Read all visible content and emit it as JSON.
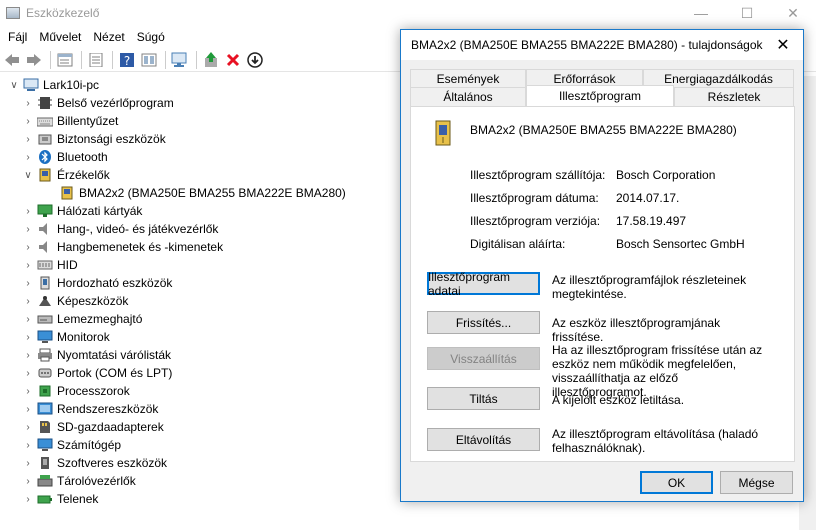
{
  "main": {
    "title": "Eszközkezelő",
    "menu": [
      "Fájl",
      "Művelet",
      "Nézet",
      "Súgó"
    ]
  },
  "tree": {
    "root": "Lark10i-pc",
    "items": [
      {
        "label": "Belső vezérlőprogram",
        "icon": "firmware-icon",
        "expanded": false
      },
      {
        "label": "Billentyűzet",
        "icon": "keyboard-icon",
        "expanded": false
      },
      {
        "label": "Biztonsági eszközök",
        "icon": "security-device-icon",
        "expanded": false
      },
      {
        "label": "Bluetooth",
        "icon": "bluetooth-icon",
        "expanded": false
      },
      {
        "label": "Érzékelők",
        "icon": "sensor-icon",
        "expanded": true
      },
      {
        "label": "BMA2x2 (BMA250E BMA255 BMA222E BMA280)",
        "icon": "sensor-device-icon",
        "child": true
      },
      {
        "label": "Hálózati kártyák",
        "icon": "network-icon",
        "expanded": false
      },
      {
        "label": "Hang-, videó- és játékvezérlők",
        "icon": "speaker-icon",
        "expanded": false
      },
      {
        "label": "Hangbemenetek és -kimenetek",
        "icon": "speaker-icon",
        "expanded": false
      },
      {
        "label": "HID",
        "icon": "hid-icon",
        "expanded": false
      },
      {
        "label": "Hordozható eszközök",
        "icon": "portable-device-icon",
        "expanded": false
      },
      {
        "label": "Képeszközök",
        "icon": "camera-icon",
        "expanded": false
      },
      {
        "label": "Lemezmeghajtó",
        "icon": "disk-icon",
        "expanded": false
      },
      {
        "label": "Monitorok",
        "icon": "monitor-icon",
        "expanded": false
      },
      {
        "label": "Nyomtatási várólisták",
        "icon": "printer-icon",
        "expanded": false
      },
      {
        "label": "Portok (COM és LPT)",
        "icon": "port-icon",
        "expanded": false
      },
      {
        "label": "Processzorok",
        "icon": "cpu-icon",
        "expanded": false
      },
      {
        "label": "Rendszereszközök",
        "icon": "system-icon",
        "expanded": false
      },
      {
        "label": "SD-gazdaadapterek",
        "icon": "sd-icon",
        "expanded": false
      },
      {
        "label": "Számítógép",
        "icon": "computer-icon",
        "expanded": false
      },
      {
        "label": "Szoftveres eszközök",
        "icon": "software-icon",
        "expanded": false
      },
      {
        "label": "Tárolóvezérlők",
        "icon": "storage-icon",
        "expanded": false
      },
      {
        "label": "Telenek",
        "icon": "battery-icon",
        "expanded": false
      }
    ]
  },
  "dialog": {
    "title": "BMA2x2 (BMA250E BMA255 BMA222E BMA280) - tulajdonságok",
    "tabs_top": [
      "Események",
      "Erőforrások",
      "Energiagazdálkodás"
    ],
    "tabs_bottom": [
      "Általános",
      "Illesztőprogram",
      "Részletek"
    ],
    "active_tab": "Illesztőprogram",
    "device_name": "BMA2x2 (BMA250E BMA255 BMA222E BMA280)",
    "props": [
      {
        "label": "Illesztőprogram szállítója:",
        "value": "Bosch Corporation"
      },
      {
        "label": "Illesztőprogram dátuma:",
        "value": "2014.07.17."
      },
      {
        "label": "Illesztőprogram verziója:",
        "value": "17.58.19.497"
      },
      {
        "label": "Digitálisan aláírta:",
        "value": "Bosch Sensortec GmbH"
      }
    ],
    "actions": [
      {
        "label": "Illesztőprogram adatai",
        "desc": "Az illesztőprogramfájlok részleteinek megtekintése.",
        "disabled": false,
        "default": true
      },
      {
        "label": "Frissítés...",
        "desc": "Az eszköz illesztőprogramjának frissítése.",
        "disabled": false
      },
      {
        "label": "Visszaállítás",
        "desc": "Ha az illesztőprogram frissítése után az eszköz nem működik megfelelően, visszaállíthatja az előző illesztőprogramot.",
        "disabled": true
      },
      {
        "label": "Tiltás",
        "desc": "A kijelölt eszköz letiltása.",
        "disabled": false
      },
      {
        "label": "Eltávolítás",
        "desc": "Az illesztőprogram eltávolítása (haladó felhasználóknak).",
        "disabled": false
      }
    ],
    "ok_label": "OK",
    "cancel_label": "Mégse"
  },
  "colors": {
    "accent": "#0078d7",
    "dialog_bg": "#f0f0f0",
    "disabled_btn": "#cccccc"
  }
}
